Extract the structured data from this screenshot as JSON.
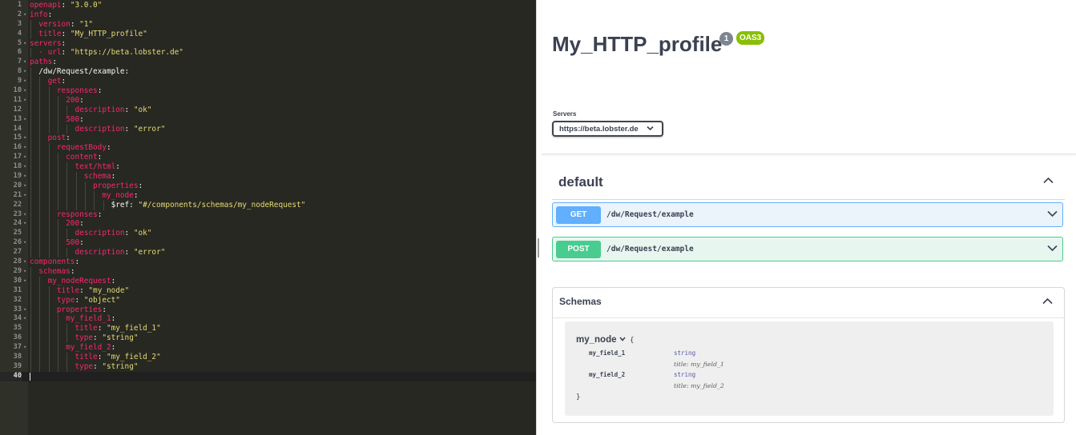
{
  "editor": {
    "lines": [
      {
        "n": "1",
        "segs": [
          [
            "k",
            "openapi"
          ],
          [
            "p",
            ": "
          ],
          [
            "s",
            "\"3.0.0\""
          ]
        ]
      },
      {
        "n": "2",
        "segs": [
          [
            "k",
            "info"
          ],
          [
            "p",
            ":"
          ]
        ],
        "fold": true
      },
      {
        "n": "3",
        "segs": [
          [
            "p",
            "  "
          ],
          [
            "k",
            "version"
          ],
          [
            "p",
            ": "
          ],
          [
            "s",
            "\"1\""
          ]
        ]
      },
      {
        "n": "4",
        "segs": [
          [
            "p",
            "  "
          ],
          [
            "k",
            "title"
          ],
          [
            "p",
            ": "
          ],
          [
            "s",
            "\"My_HTTP_profile\""
          ]
        ]
      },
      {
        "n": "5",
        "segs": [
          [
            "k",
            "servers"
          ],
          [
            "p",
            ":"
          ]
        ],
        "fold": true
      },
      {
        "n": "6",
        "segs": [
          [
            "p",
            "  "
          ],
          [
            "k",
            "- url"
          ],
          [
            "p",
            ": "
          ],
          [
            "s",
            "\"https://beta.lobster.de\""
          ]
        ]
      },
      {
        "n": "7",
        "segs": [
          [
            "k",
            "paths"
          ],
          [
            "p",
            ":"
          ]
        ],
        "fold": true
      },
      {
        "n": "8",
        "segs": [
          [
            "p",
            "  /dw/Request/example:"
          ]
        ],
        "fold": true
      },
      {
        "n": "9",
        "segs": [
          [
            "p",
            "    "
          ],
          [
            "k",
            "get"
          ],
          [
            "p",
            ":"
          ]
        ],
        "fold": true
      },
      {
        "n": "10",
        "segs": [
          [
            "p",
            "      "
          ],
          [
            "k",
            "responses"
          ],
          [
            "p",
            ":"
          ]
        ],
        "fold": true
      },
      {
        "n": "11",
        "segs": [
          [
            "p",
            "        "
          ],
          [
            "k",
            "200"
          ],
          [
            "p",
            ":"
          ]
        ],
        "fold": true
      },
      {
        "n": "12",
        "segs": [
          [
            "p",
            "          "
          ],
          [
            "k",
            "description"
          ],
          [
            "p",
            ": "
          ],
          [
            "s",
            "\"ok\""
          ]
        ]
      },
      {
        "n": "13",
        "segs": [
          [
            "p",
            "        "
          ],
          [
            "k",
            "500"
          ],
          [
            "p",
            ":"
          ]
        ],
        "fold": true
      },
      {
        "n": "14",
        "segs": [
          [
            "p",
            "          "
          ],
          [
            "k",
            "description"
          ],
          [
            "p",
            ": "
          ],
          [
            "s",
            "\"error\""
          ]
        ]
      },
      {
        "n": "15",
        "segs": [
          [
            "p",
            "    "
          ],
          [
            "k",
            "post"
          ],
          [
            "p",
            ":"
          ]
        ],
        "fold": true
      },
      {
        "n": "16",
        "segs": [
          [
            "p",
            "      "
          ],
          [
            "k",
            "requestBody"
          ],
          [
            "p",
            ":"
          ]
        ],
        "fold": true
      },
      {
        "n": "17",
        "segs": [
          [
            "p",
            "        "
          ],
          [
            "k",
            "content"
          ],
          [
            "p",
            ":"
          ]
        ],
        "fold": true
      },
      {
        "n": "18",
        "segs": [
          [
            "p",
            "          "
          ],
          [
            "k",
            "text/html"
          ],
          [
            "p",
            ":"
          ]
        ],
        "fold": true
      },
      {
        "n": "19",
        "segs": [
          [
            "p",
            "            "
          ],
          [
            "k",
            "schema"
          ],
          [
            "p",
            ":"
          ]
        ],
        "fold": true
      },
      {
        "n": "20",
        "segs": [
          [
            "p",
            "              "
          ],
          [
            "k",
            "properties"
          ],
          [
            "p",
            ":"
          ]
        ],
        "fold": true
      },
      {
        "n": "21",
        "segs": [
          [
            "p",
            "                "
          ],
          [
            "k",
            "my_node"
          ],
          [
            "p",
            ":"
          ]
        ],
        "fold": true
      },
      {
        "n": "22",
        "segs": [
          [
            "p",
            "                  $ref: "
          ],
          [
            "s",
            "\"#/components/schemas/my_nodeRequest\""
          ]
        ]
      },
      {
        "n": "23",
        "segs": [
          [
            "p",
            "      "
          ],
          [
            "k",
            "responses"
          ],
          [
            "p",
            ":"
          ]
        ],
        "fold": true
      },
      {
        "n": "24",
        "segs": [
          [
            "p",
            "        "
          ],
          [
            "k",
            "200"
          ],
          [
            "p",
            ":"
          ]
        ],
        "fold": true
      },
      {
        "n": "25",
        "segs": [
          [
            "p",
            "          "
          ],
          [
            "k",
            "description"
          ],
          [
            "p",
            ": "
          ],
          [
            "s",
            "\"ok\""
          ]
        ]
      },
      {
        "n": "26",
        "segs": [
          [
            "p",
            "        "
          ],
          [
            "k",
            "500"
          ],
          [
            "p",
            ":"
          ]
        ],
        "fold": true
      },
      {
        "n": "27",
        "segs": [
          [
            "p",
            "          "
          ],
          [
            "k",
            "description"
          ],
          [
            "p",
            ": "
          ],
          [
            "s",
            "\"error\""
          ]
        ]
      },
      {
        "n": "28",
        "segs": [
          [
            "k",
            "components"
          ],
          [
            "p",
            ":"
          ]
        ],
        "fold": true
      },
      {
        "n": "29",
        "segs": [
          [
            "p",
            "  "
          ],
          [
            "k",
            "schemas"
          ],
          [
            "p",
            ":"
          ]
        ],
        "fold": true
      },
      {
        "n": "30",
        "segs": [
          [
            "p",
            "    "
          ],
          [
            "k",
            "my_nodeRequest"
          ],
          [
            "p",
            ":"
          ]
        ],
        "fold": true
      },
      {
        "n": "31",
        "segs": [
          [
            "p",
            "      "
          ],
          [
            "k",
            "title"
          ],
          [
            "p",
            ": "
          ],
          [
            "s",
            "\"my_node\""
          ]
        ]
      },
      {
        "n": "32",
        "segs": [
          [
            "p",
            "      "
          ],
          [
            "k",
            "type"
          ],
          [
            "p",
            ": "
          ],
          [
            "s",
            "\"object\""
          ]
        ]
      },
      {
        "n": "33",
        "segs": [
          [
            "p",
            "      "
          ],
          [
            "k",
            "properties"
          ],
          [
            "p",
            ":"
          ]
        ],
        "fold": true
      },
      {
        "n": "34",
        "segs": [
          [
            "p",
            "        "
          ],
          [
            "k",
            "my_field_1"
          ],
          [
            "p",
            ":"
          ]
        ],
        "fold": true
      },
      {
        "n": "35",
        "segs": [
          [
            "p",
            "          "
          ],
          [
            "k",
            "title"
          ],
          [
            "p",
            ": "
          ],
          [
            "s",
            "\"my_field_1\""
          ]
        ]
      },
      {
        "n": "36",
        "segs": [
          [
            "p",
            "          "
          ],
          [
            "k",
            "type"
          ],
          [
            "p",
            ": "
          ],
          [
            "s",
            "\"string\""
          ]
        ]
      },
      {
        "n": "37",
        "segs": [
          [
            "p",
            "        "
          ],
          [
            "k",
            "my_field_2"
          ],
          [
            "p",
            ":"
          ]
        ],
        "fold": true
      },
      {
        "n": "38",
        "segs": [
          [
            "p",
            "          "
          ],
          [
            "k",
            "title"
          ],
          [
            "p",
            ": "
          ],
          [
            "s",
            "\"my_field_2\""
          ]
        ]
      },
      {
        "n": "39",
        "segs": [
          [
            "p",
            "          "
          ],
          [
            "k",
            "type"
          ],
          [
            "p",
            ": "
          ],
          [
            "s",
            "\"string\""
          ]
        ]
      },
      {
        "n": "40",
        "segs": [],
        "active": true
      }
    ]
  },
  "swagger": {
    "title": "My_HTTP_profile",
    "version_badge": "1",
    "oas_badge": "OAS3",
    "servers_label": "Servers",
    "selected_server": "https://beta.lobster.de",
    "tag": "default",
    "operations": [
      {
        "method": "GET",
        "path": "/dw/Request/example"
      },
      {
        "method": "POST",
        "path": "/dw/Request/example"
      }
    ],
    "schemas_label": "Schemas",
    "model": {
      "name": "my_node",
      "open_brace": "{",
      "close_brace": "}",
      "props": [
        {
          "name": "my_field_1",
          "type": "string",
          "title_label": "title:",
          "title_value": "my_field_1",
          "display_title": "title: my_field_1"
        },
        {
          "name": "my_field_2",
          "type": "string",
          "title_label": "title:",
          "title_value": "my_field_2",
          "display_title": "title: my_field_2"
        }
      ]
    }
  },
  "colors": {
    "editor_bg": "#272822",
    "key": "#f92672",
    "string": "#e6db74",
    "get": "#61affe",
    "post": "#49cc90",
    "oas_badge": "#89bf04"
  },
  "icons": [
    "chevron-down-icon",
    "chevron-up-icon",
    "fold-arrow-icon"
  ]
}
